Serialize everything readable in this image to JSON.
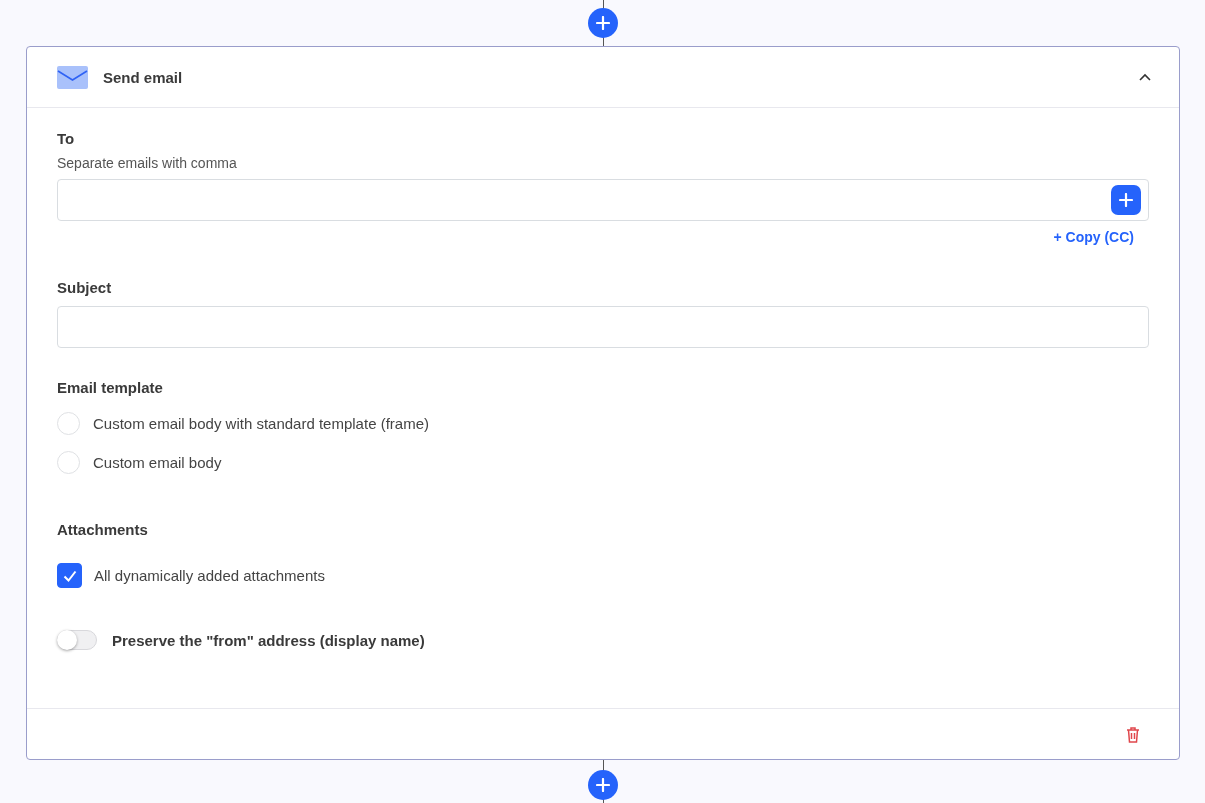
{
  "card": {
    "title": "Send email",
    "expanded": true
  },
  "to": {
    "label": "To",
    "hint": "Separate emails with comma",
    "cc_link": "+ Copy (CC)"
  },
  "subject": {
    "label": "Subject"
  },
  "template": {
    "label": "Email template",
    "options": [
      {
        "label": "Custom email body with standard template (frame)",
        "selected": false
      },
      {
        "label": "Custom email body",
        "selected": false
      }
    ]
  },
  "attachments": {
    "label": "Attachments",
    "options": [
      {
        "label": "All dynamically added attachments",
        "checked": true
      }
    ]
  },
  "preserve_from": {
    "label": "Preserve the \"from\" address (display name)",
    "on": false
  }
}
